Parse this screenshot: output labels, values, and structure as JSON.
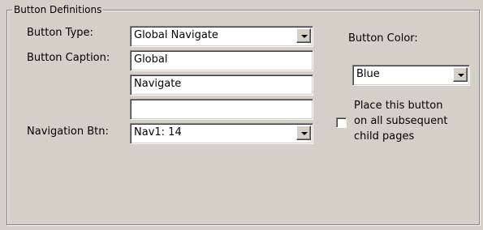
{
  "group": {
    "title": "Button Definitions"
  },
  "labels": {
    "button_type": "Button Type:",
    "button_caption": "Button Caption:",
    "navigation_btn": "Navigation Btn:",
    "button_color": "Button Color:"
  },
  "fields": {
    "button_type": "Global Navigate",
    "caption_line1": "Global",
    "caption_line2": "Navigate",
    "caption_line3": "",
    "navigation_btn": "Nav1: 14",
    "button_color": "Blue"
  },
  "checkbox": {
    "label_line1": "Place this button",
    "label_line2": "on all subsequent",
    "label_line3": "child pages",
    "checked": false
  }
}
